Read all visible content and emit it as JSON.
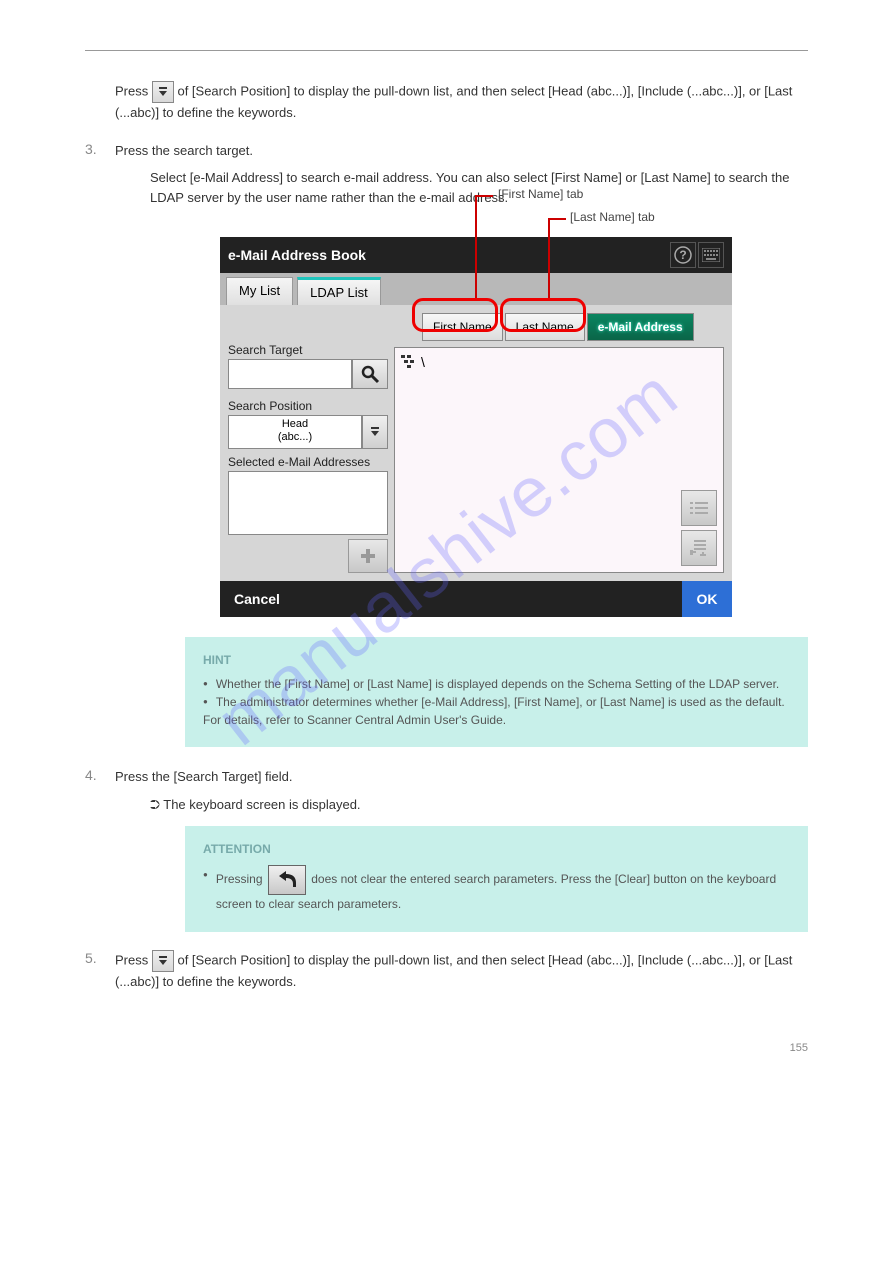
{
  "steps": {
    "s2": "Press the [Search Position] to display the pull-down list, and then select [Head (abc...)], [Include (...abc...)], or [Last (...abc)] to define the keywords.",
    "s3": "Press the search target.",
    "s3_note": "Select [e-Mail Address] to search e-mail address. You can also select [First Name] or [Last Name] to search the LDAP server by the user name rather than the e-mail address.",
    "dropdown_prefix": "Press ",
    "dropdown_suffix": " of [Search Position] to display the pull-down list, and then select [Head (abc...)], [Include (...abc...)], or [Last (...abc)] to define the keywords."
  },
  "labels": {
    "label_a": "[First Name] tab",
    "label_b": "[Last Name] tab"
  },
  "app": {
    "title": "e-Mail Address Book",
    "tabs": {
      "mylist": "My List",
      "ldap": "LDAP List"
    },
    "filters": {
      "first": "First Name",
      "last": "Last Name",
      "email": "e-Mail Address"
    },
    "search_target": "Search Target",
    "search_position": "Search Position",
    "position_value_line1": "Head",
    "position_value_line2": "(abc...)",
    "selected_label": "Selected e-Mail Addresses",
    "list_prefix": "\\",
    "cancel": "Cancel",
    "ok": "OK"
  },
  "hint": {
    "title": "HINT",
    "items": [
      "Whether the [First Name] or [Last Name] is displayed depends on the Schema Setting of the LDAP server.",
      "The administrator determines whether [e-Mail Address], [First Name], or [Last Name] is used as the default. For details, refer to Scanner Central Admin User's Guide."
    ]
  },
  "step4": {
    "num": "4.",
    "text": "Press the [Search Target] field.",
    "sub": "The keyboard screen is displayed."
  },
  "attention": {
    "title": "ATTENTION",
    "line1_before": "Pressing ",
    "line1_after": " does not clear the entered search parameters. Press the [Clear] button on the keyboard screen to clear search parameters."
  },
  "step5": {
    "prefix": "Press ",
    "suffix": " of [Search Position] to display the pull-down list, and then select [Head (abc...)], [Include (...abc...)], or [Last (...abc)] to define the keywords."
  },
  "watermark": "manualshive.com",
  "footer": "155"
}
